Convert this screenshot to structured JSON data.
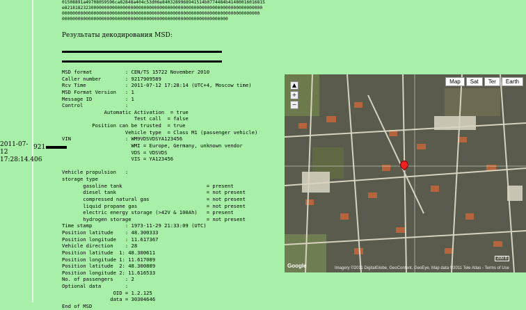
{
  "record": {
    "timestamp": "2011-07-12 17:28:14.406",
    "caller_prefix": "921"
  },
  "hex_lines": [
    "01508891a49708059596ca82848a404c53d06e8403289968941514b0774484b41480016016815",
    "e821818232300000000000000000000000000000000000000000000000000000000000000000",
    "000000000000000000000000000000000000000000000000000000000000000000000000000",
    "000000000000000000000000000000000000000000000000000000000000000"
  ],
  "decode_heading": "Результаты декодирования MSD:",
  "msd_text": "MSD format           : CEN/TS 15722 November 2010\nCaller number        : 9217909589\nRcv Time             : 2011-07-12 17:28:14 (UTC+4, Moscow time)\nMSD Format Version   : 1\nMessage ID           : 1\nControl              :\n              Automatic Activation  = true\n                        Test call  = false\n          Position can be trusted  = true\n                     Vehicle type  = Class M1 (passenger vehicle)\nVIN                  : WM9VDSVDSYA123456\n                       WMI = Europe, Germany, unknown vendor\n                       VDS = VDSVDS\n                       VIS = YA123456\n\nVehicle propulsion   :\nstorage type\n       gasoline tank                            = present\n       diesel tank                              = not present\n       compressed natural gas                   = not present\n       liquid propane gas                       = not present\n       electric energy storage (>42V & 100Ah)   = present\n       hydrogen storage                         = not present\nTime stamp           : 1973-11-29 21:33:09 (UTC)\nPosition latitude    : 48.300333\nPosition longitude   : 11.617367\nVehicle direction    : 28\nPosition latitude  1: 48.300611\nPosition longitude 1: 11.617089\nPosition latitude  2: 48.300889\nPosition longitude 2: 11.616533\nNo. of passengers    : 2\nOptional data        :\n                 OID = 1.2.125\n                data = 30304646\nEnd of MSD",
  "map": {
    "buttons": [
      "Map",
      "Sat",
      "Ter",
      "Earth"
    ],
    "copyright": "Imagery ©2011 DigitalGlobe, GeoContent, GeoEye, Map data ©2011 Tele Atlas - Terms of Use",
    "logo": "Google",
    "scale": "200 ft",
    "road_color": "#d8d2c0",
    "roof_color": "#b5643c"
  }
}
